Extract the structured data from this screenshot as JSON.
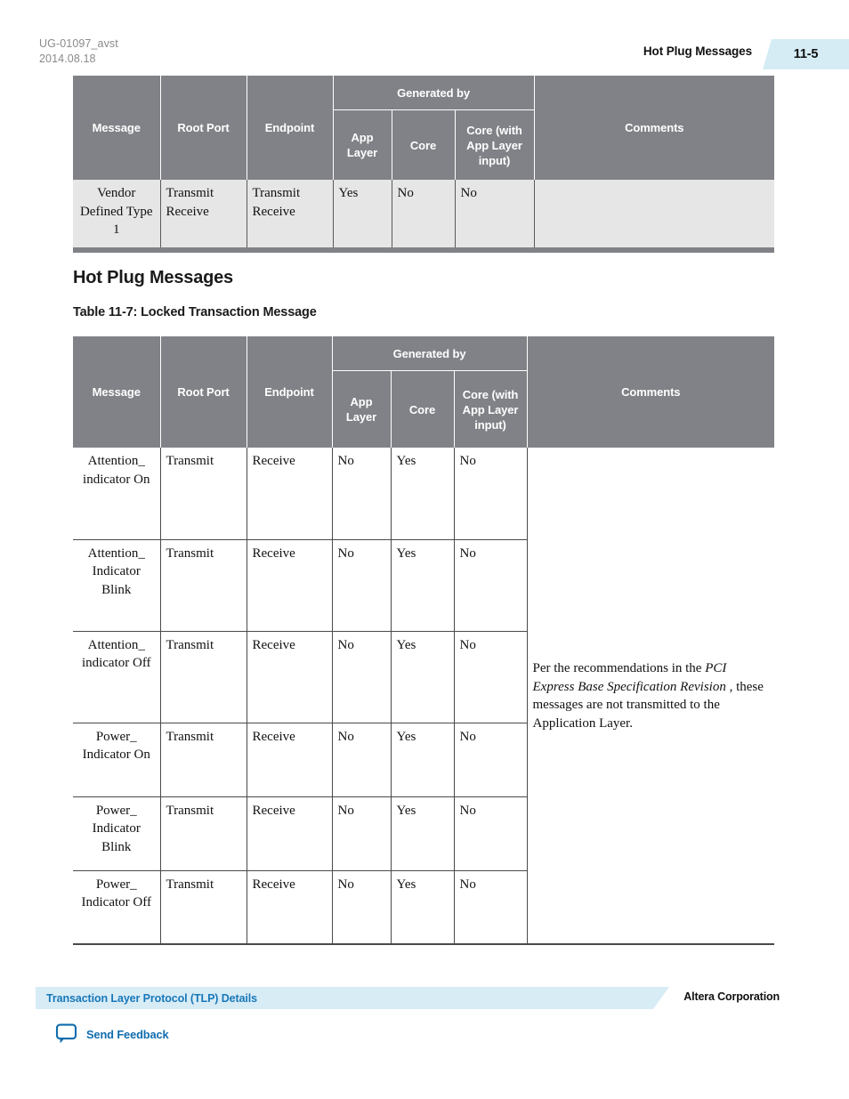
{
  "header": {
    "doc_id": "UG-01097_avst",
    "doc_date": "2014.08.18",
    "chapter": "Hot Plug Messages",
    "page_number": "11-5",
    "badge_color": "#d5ecf5"
  },
  "table_vendor": {
    "columns": {
      "message": "Message",
      "root_port": "Root Port",
      "endpoint": "Endpoint",
      "generated_by": "Generated by",
      "app_layer": "App Layer",
      "core": "Core",
      "core_with_app": "Core (with App Layer input)",
      "comments": "Comments"
    },
    "rows": [
      {
        "message": "Vendor Defined Type 1",
        "root_port": "Transmit Receive",
        "endpoint": "Transmit Receive",
        "app_layer": "Yes",
        "core": "No",
        "core_with_app": "No",
        "comments": ""
      }
    ],
    "header_bg": "#808287",
    "row_bg": "#e6e6e6"
  },
  "section": {
    "heading": "Hot Plug Messages",
    "caption": "Table 11-7: Locked Transaction Message"
  },
  "table_locked": {
    "columns": {
      "message": "Message",
      "root_port": "Root Port",
      "endpoint": "Endpoint",
      "generated_by": "Generated by",
      "app_layer": "App Layer",
      "core": "Core",
      "core_with_app": "Core (with App Layer input)",
      "comments": "Comments"
    },
    "rows": [
      {
        "message": "Attention_ indicator On",
        "root_port": "Transmit",
        "endpoint": "Receive",
        "app_layer": "No",
        "core": "Yes",
        "core_with_app": "No"
      },
      {
        "message": "Attention_ Indicator Blink",
        "root_port": "Transmit",
        "endpoint": "Receive",
        "app_layer": "No",
        "core": "Yes",
        "core_with_app": "No"
      },
      {
        "message": "Attention_ indicator Off",
        "root_port": "Transmit",
        "endpoint": "Receive",
        "app_layer": "No",
        "core": "Yes",
        "core_with_app": "No"
      },
      {
        "message": "Power_ Indicator On",
        "root_port": "Transmit",
        "endpoint": "Receive",
        "app_layer": "No",
        "core": "Yes",
        "core_with_app": "No"
      },
      {
        "message": "Power_ Indicator Blink",
        "root_port": "Transmit",
        "endpoint": "Receive",
        "app_layer": "No",
        "core": "Yes",
        "core_with_app": "No"
      },
      {
        "message": "Power_ Indicator Off",
        "root_port": "Transmit",
        "endpoint": "Receive",
        "app_layer": "No",
        "core": "Yes",
        "core_with_app": "No"
      }
    ],
    "comments": {
      "lead": "Per the recommendations in the ",
      "italic": "PCI Express Base Specification Revision",
      "tail": " , these messages are not transmitted to the Application Layer."
    },
    "header_bg": "#808287"
  },
  "footer": {
    "banner_text": "Transaction Layer Protocol (TLP) Details",
    "corporation": "Altera Corporation",
    "feedback_label": "Send Feedback",
    "banner_color": "#d8ecf6",
    "link_color": "#1878b8"
  }
}
